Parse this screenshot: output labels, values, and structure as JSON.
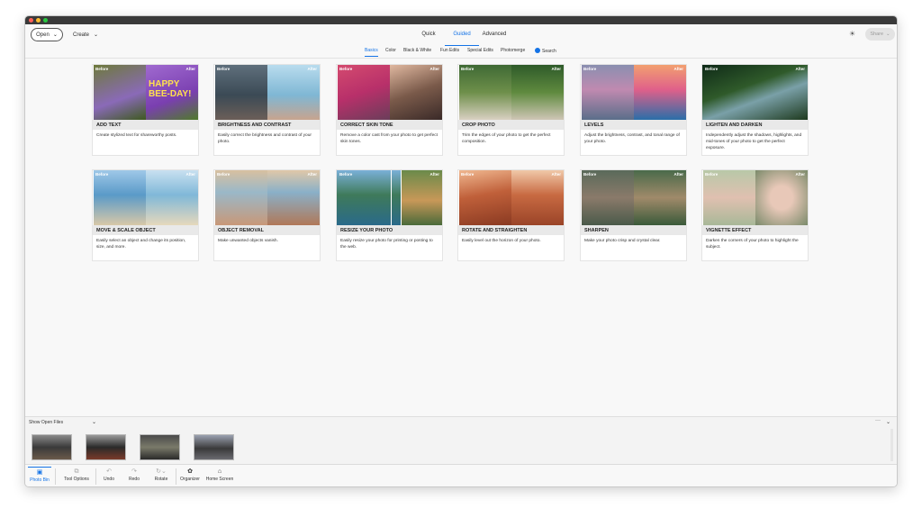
{
  "topbar": {
    "open_label": "Open",
    "create_label": "Create",
    "modes": [
      "Quick",
      "Guided",
      "Advanced"
    ],
    "active_mode": "Guided",
    "share_label": "Share"
  },
  "subtabs": {
    "items": [
      "Basics",
      "Color",
      "Black & White",
      "Fun Edits",
      "Special Edits",
      "Photomerge",
      "Search"
    ],
    "active": "Basics"
  },
  "cards": [
    {
      "title": "ADD TEXT",
      "desc": "Create stylized text for shareworthy posts.",
      "before": "Before",
      "after": "After"
    },
    {
      "title": "BRIGHTNESS AND CONTRAST",
      "desc": "Easily correct the brightness and contrast of your photo.",
      "before": "Before",
      "after": "After"
    },
    {
      "title": "CORRECT SKIN TONE",
      "desc": "Remove a color cast from your photo to get perfect skin tones.",
      "before": "Before",
      "after": "After"
    },
    {
      "title": "CROP PHOTO",
      "desc": "Trim the edges of your photo to get the perfect composition.",
      "before": "Before",
      "after": "After"
    },
    {
      "title": "LEVELS",
      "desc": "Adjust the brightness, contrast, and tonal range of your photo.",
      "before": "Before",
      "after": "After"
    },
    {
      "title": "LIGHTEN AND DARKEN",
      "desc": "Independently adjust the shadows, highlights, and mid-tones of your photo to get the perfect exposure.",
      "before": "Before",
      "after": "After"
    },
    {
      "title": "MOVE & SCALE OBJECT",
      "desc": "Easily select an object and change its position, size, and more.",
      "before": "Before",
      "after": "After"
    },
    {
      "title": "OBJECT REMOVAL",
      "desc": "Make unwanted objects vanish.",
      "before": "Before",
      "after": "After"
    },
    {
      "title": "RESIZE YOUR PHOTO",
      "desc": "Easily resize your photo for printing or posting to the web.",
      "before": "Before",
      "after": "After"
    },
    {
      "title": "ROTATE AND STRAIGHTEN",
      "desc": "Easily level out the horizon of your photo.",
      "before": "Before",
      "after": "After"
    },
    {
      "title": "SHARPEN",
      "desc": "Make your photo crisp and crystal clear.",
      "before": "Before",
      "after": "After"
    },
    {
      "title": "VIGNETTE EFFECT",
      "desc": "Darken the corners of your photo to highlight the subject.",
      "before": "Before",
      "after": "After"
    }
  ],
  "bin": {
    "label": "Show Open Files"
  },
  "toolbar": {
    "items": [
      {
        "label": "Photo Bin",
        "icon": "photo-bin-icon"
      },
      {
        "label": "Tool Options",
        "icon": "tool-options-icon"
      },
      {
        "label": "Undo",
        "icon": "undo-icon"
      },
      {
        "label": "Redo",
        "icon": "redo-icon"
      },
      {
        "label": "Rotate",
        "icon": "rotate-icon"
      },
      {
        "label": "Organizer",
        "icon": "organizer-icon"
      },
      {
        "label": "Home Screen",
        "icon": "home-icon"
      }
    ],
    "active": "Photo Bin"
  },
  "colors": {
    "accent": "#1473e6"
  }
}
